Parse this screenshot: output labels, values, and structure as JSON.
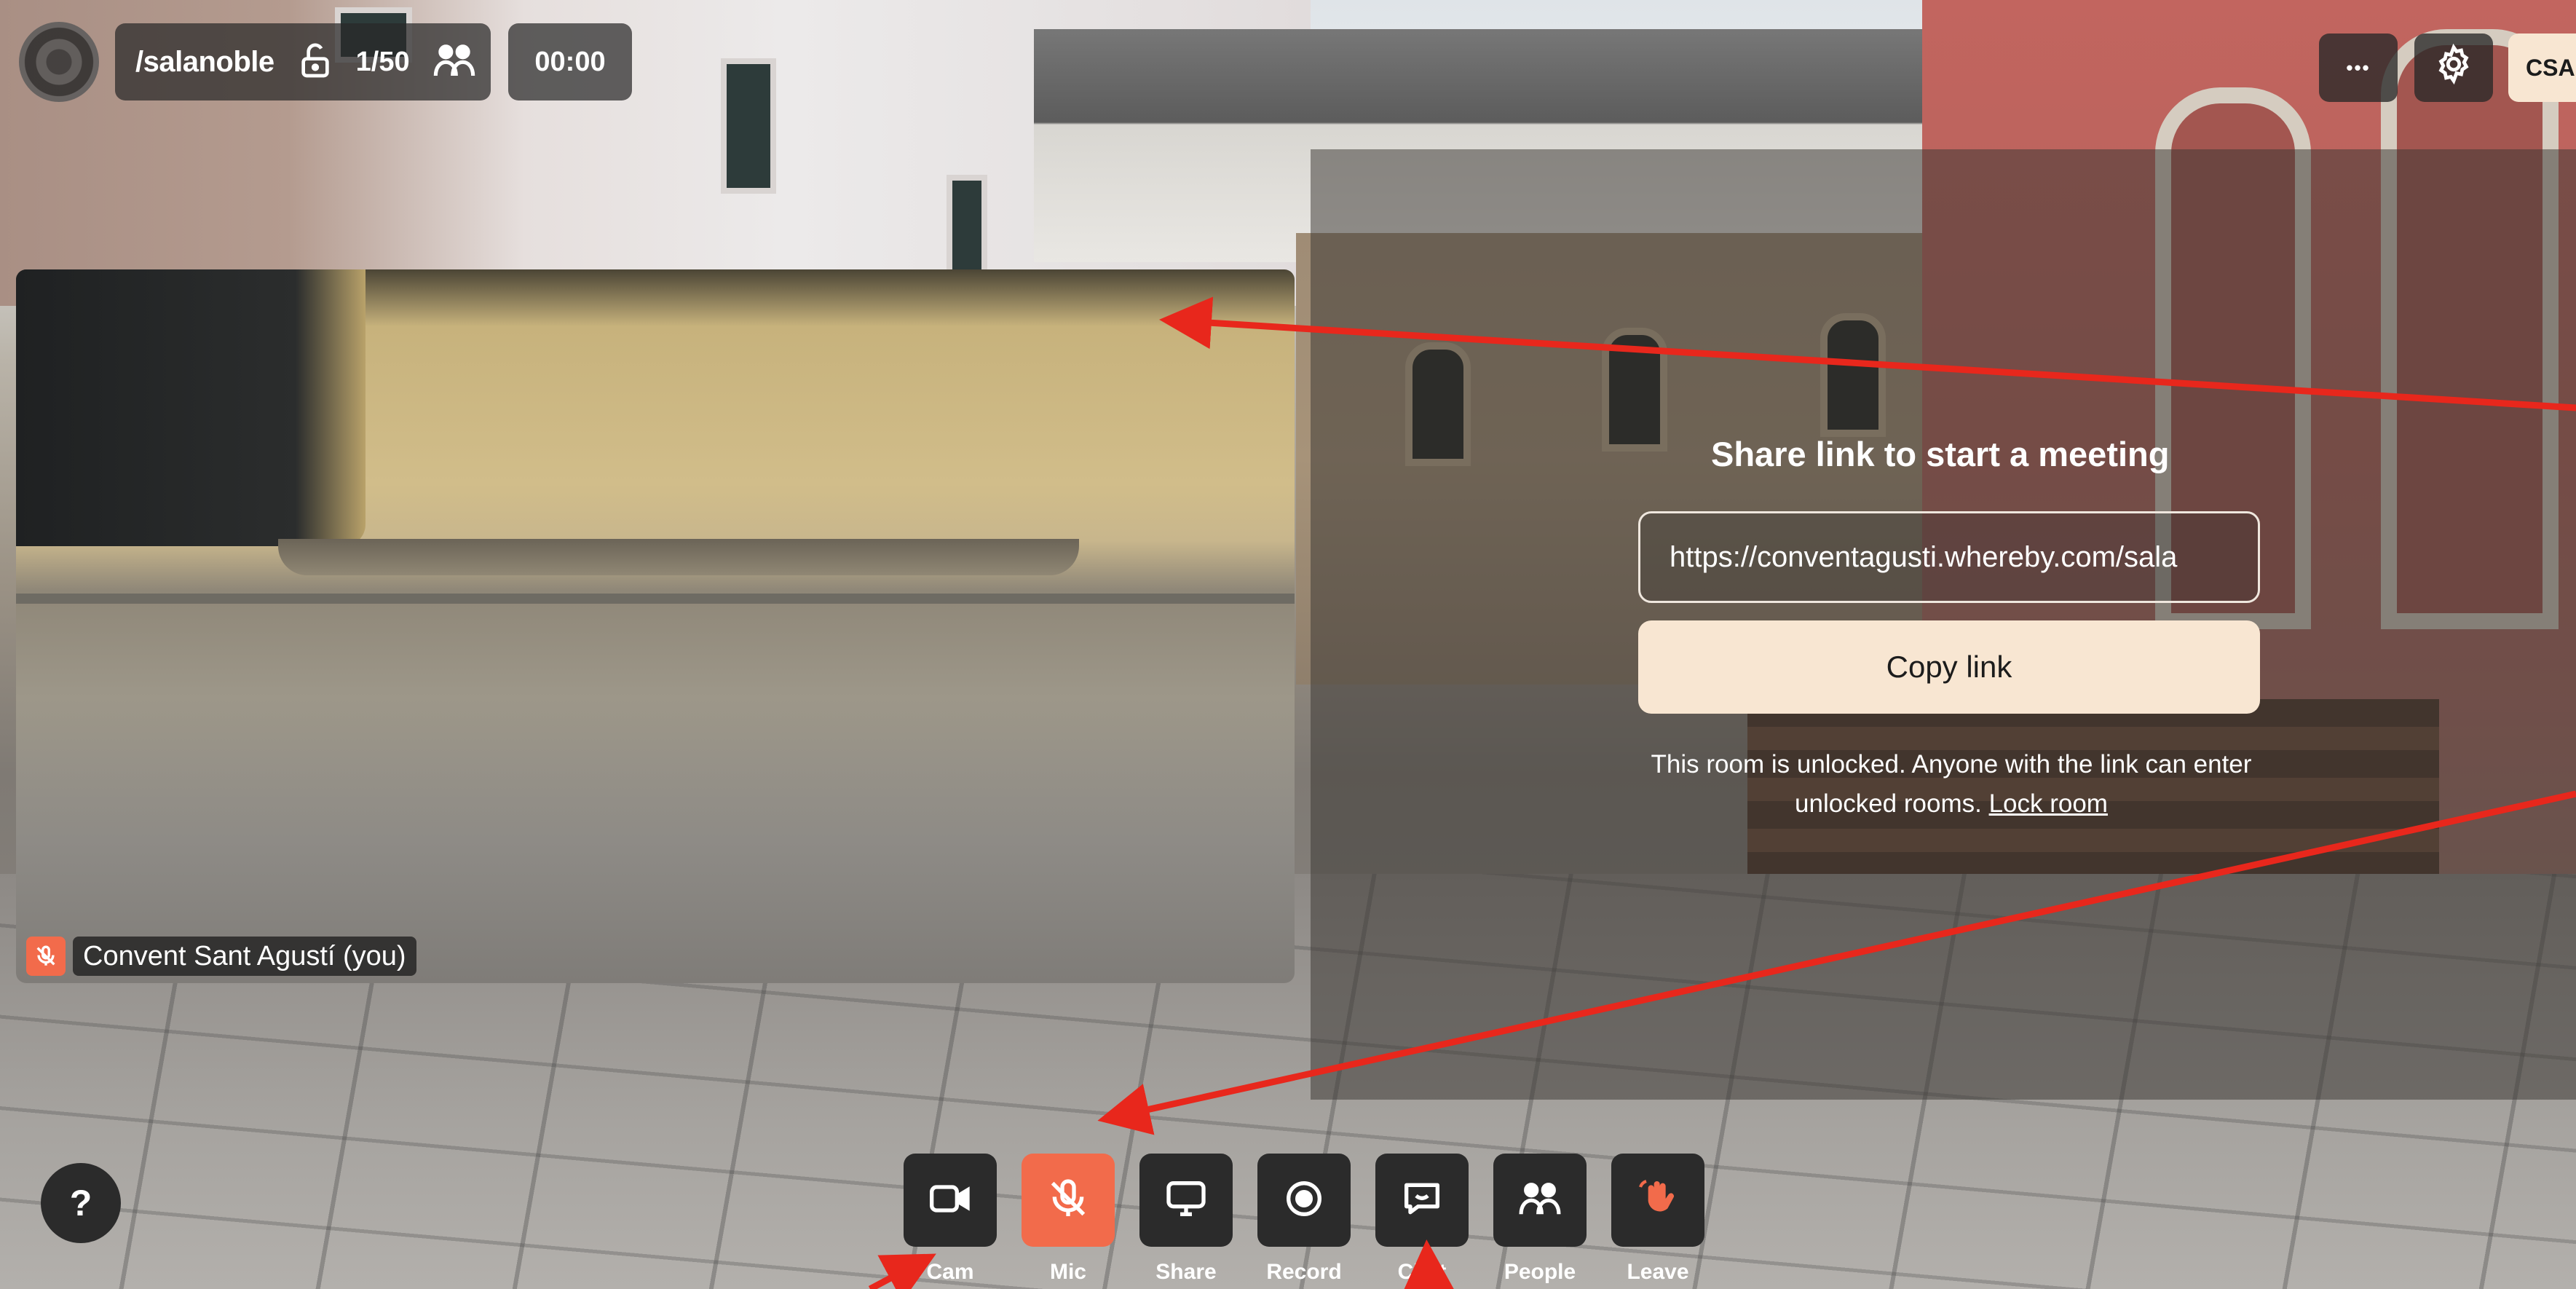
{
  "topbar": {
    "room_name": "/salanoble",
    "participant_count": "1/50",
    "timer": "00:00",
    "avatar_initials": "CSA"
  },
  "self_video": {
    "participant_label": "Convent Sant Agustí (you)"
  },
  "share_panel": {
    "title": "Share link to start a meeting",
    "link_value": "https://conventagusti.whereby.com/sala",
    "copy_label": "Copy link",
    "unlock_text": "This room is unlocked. Anyone with the link can enter unlocked rooms.",
    "lock_link_label": "Lock room"
  },
  "toolbar": {
    "cam": "Cam",
    "mic": "Mic",
    "share": "Share",
    "record": "Record",
    "chat": "Chat",
    "people": "People",
    "leave": "Leave"
  },
  "help_label": "?",
  "more_label": "•••",
  "colors": {
    "accent": "#f26b4b",
    "cream": "#f8e6d2",
    "annotation": "#e8271c"
  }
}
